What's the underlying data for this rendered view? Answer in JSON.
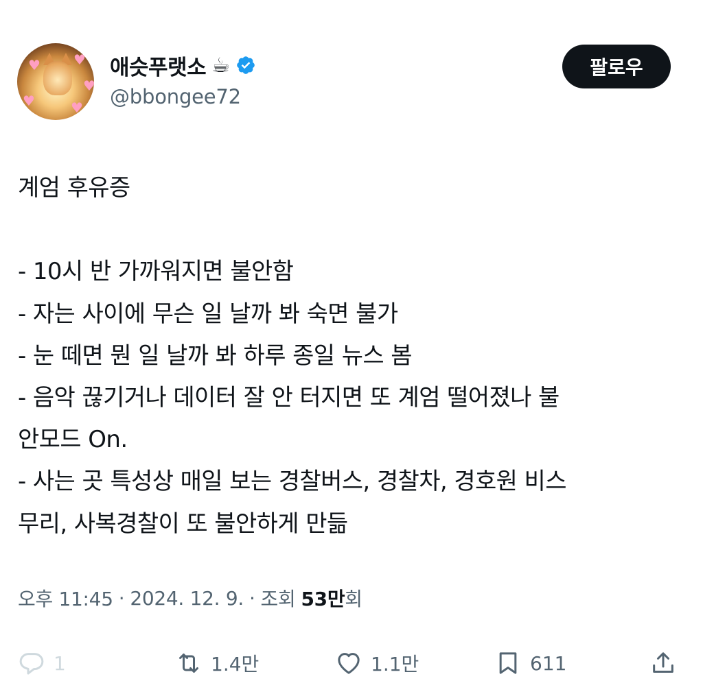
{
  "author": {
    "display_name": "애슷푸랫소",
    "name_emoji": "☕",
    "handle": "@bbongee72"
  },
  "follow_label": "팔로우",
  "tweet": {
    "lines": [
      "계엄 후유증",
      "",
      "- 10시 반 가까워지면 불안함",
      "- 자는 사이에 무슨 일 날까 봐 숙면 불가",
      "- 눈 떼면 뭔 일 날까 봐 하루 종일 뉴스 봄",
      "- 음악 끊기거나 데이터 잘 안 터지면 또 계엄 떨어졌나 불",
      "안모드 On.",
      "- 사는 곳 특성상 매일 보는 경찰버스, 경찰차, 경호원 비스",
      "무리, 사복경찰이 또 불안하게 만듦"
    ]
  },
  "meta": {
    "time": "오후 11:45",
    "sep1": "·",
    "date": "2024. 12. 9.",
    "sep2": "·",
    "views_label": "조회",
    "views_count": "53만",
    "views_suffix": "회"
  },
  "actions": {
    "reply": {
      "icon": "reply-icon",
      "count": "1"
    },
    "retweet": {
      "icon": "retweet-icon",
      "count": "1.4만"
    },
    "like": {
      "icon": "heart-icon",
      "count": "1.1만"
    },
    "bookmark": {
      "icon": "bookmark-icon",
      "count": "611"
    },
    "share": {
      "icon": "share-icon"
    }
  },
  "colors": {
    "text": "#0f1419",
    "secondary": "#536471",
    "reply_muted": "#cfd9de",
    "verified": "#1d9bf0",
    "button_bg": "#0f1419"
  }
}
